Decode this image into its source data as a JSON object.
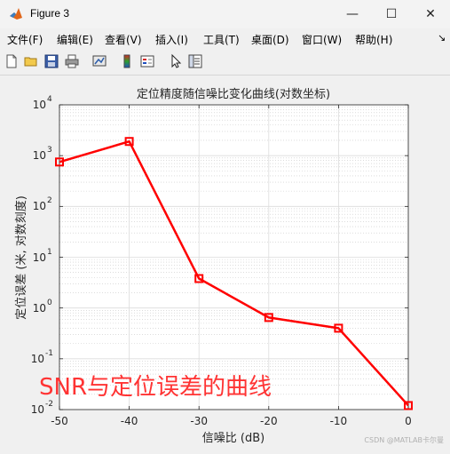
{
  "window": {
    "title": "Figure 3",
    "minimize_glyph": "—",
    "maximize_glyph": "☐",
    "close_glyph": "✕"
  },
  "menu": {
    "items": [
      {
        "label": "文件(F)"
      },
      {
        "label": "编辑(E)"
      },
      {
        "label": "查看(V)"
      },
      {
        "label": "插入(I)"
      },
      {
        "label": "工具(T)"
      },
      {
        "label": "桌面(D)"
      },
      {
        "label": "窗口(W)"
      },
      {
        "label": "帮助(H)"
      }
    ],
    "overflow_glyph": "↘"
  },
  "toolbar": {
    "icons": [
      "new-figure-icon",
      "open-folder-icon",
      "save-icon",
      "print-icon",
      "link-plot-icon",
      "colorbar-icon",
      "legend-icon",
      "edit-plot-cursor-icon",
      "property-inspector-icon"
    ]
  },
  "overlay": {
    "caption": "SNR与定位误差的曲线",
    "caption_color": "#ff3333",
    "watermark": "CSDN @MATLAB卡尔曼"
  },
  "chart_data": {
    "type": "line",
    "title": "定位精度随信噪比变化曲线(对数坐标)",
    "xlabel": "信噪比 (dB)",
    "ylabel": "定位误差 (米, 对数刻度)",
    "x": [
      -50,
      -40,
      -30,
      -20,
      -10,
      0
    ],
    "series": [
      {
        "values": [
          750,
          1900,
          3.8,
          0.65,
          0.4,
          0.012
        ],
        "color": "#ff0000",
        "marker": "square"
      }
    ],
    "xlim": [
      -50,
      0
    ],
    "ylim": [
      0.01,
      10000
    ],
    "y_scale": "log",
    "xticks": [
      "-50",
      "-40",
      "-30",
      "-20",
      "-10",
      "0"
    ],
    "yticks": [
      {
        "base": "10",
        "exp": "-2"
      },
      {
        "base": "10",
        "exp": "-1"
      },
      {
        "base": "10",
        "exp": "0"
      },
      {
        "base": "10",
        "exp": "1"
      },
      {
        "base": "10",
        "exp": "2"
      },
      {
        "base": "10",
        "exp": "3"
      },
      {
        "base": "10",
        "exp": "4"
      }
    ],
    "grid": true
  }
}
